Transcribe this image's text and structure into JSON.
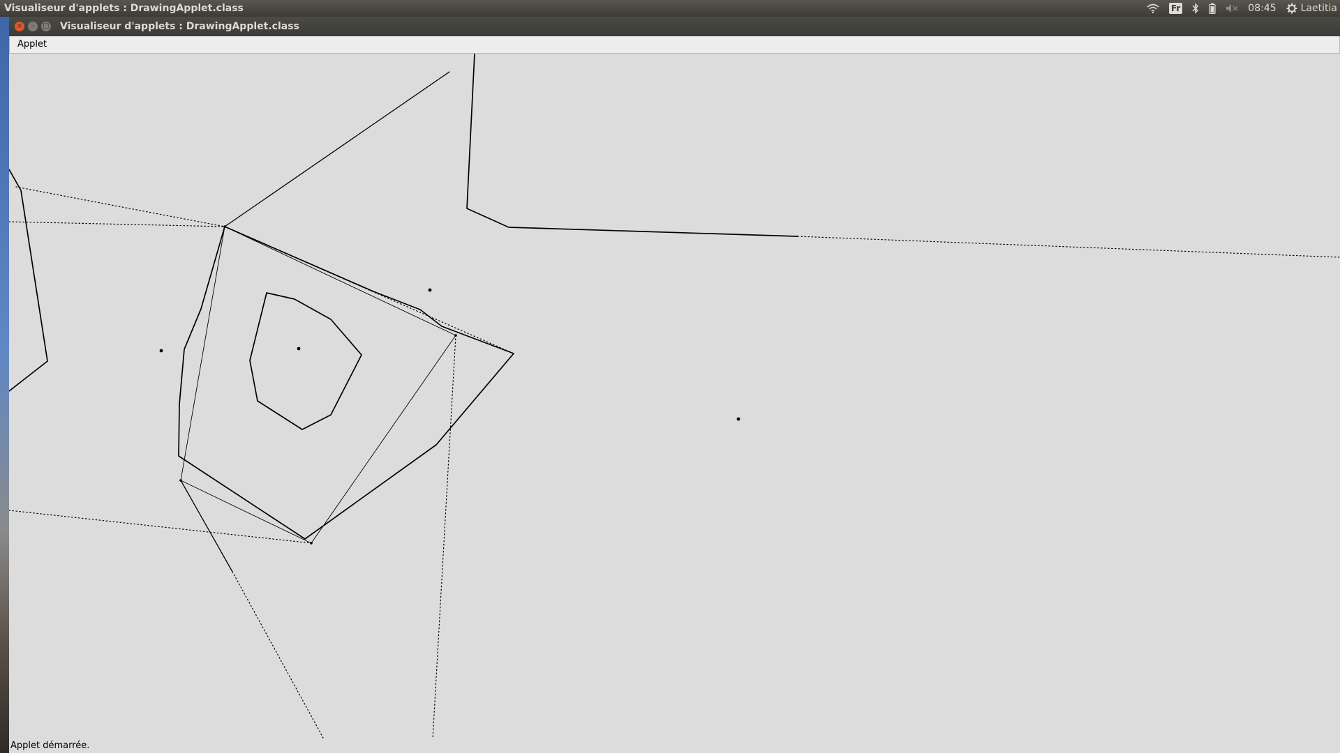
{
  "desktop_panel": {
    "window_title": "Visualiseur d'applets : DrawingApplet.class",
    "indicators": {
      "wifi_icon": "wifi-icon",
      "keyboard_layout": "Fr",
      "bluetooth_icon": "bluetooth-icon",
      "battery_icon": "battery-icon",
      "volume_icon": "volume-muted-icon",
      "clock": "08:45",
      "settings_icon": "gear-icon",
      "user": "Laetitia"
    }
  },
  "window": {
    "title": "Visualiseur d'applets : DrawingApplet.class",
    "controls": {
      "close": "×",
      "minimize": "–",
      "maximize": "□"
    },
    "menu": [
      "Applet"
    ],
    "status": "Applet démarrée."
  },
  "colors": {
    "canvas_bg": "#dcdcdc",
    "stroke": "#000000",
    "panel_bg": "#3c3b37",
    "close_button": "#e95420"
  }
}
